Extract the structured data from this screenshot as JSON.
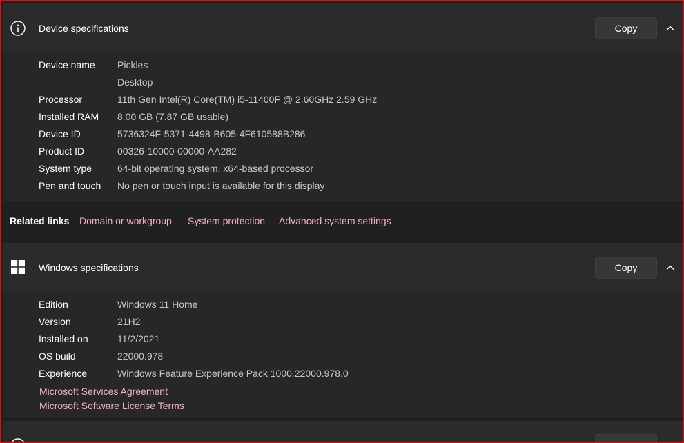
{
  "device_specs": {
    "title": "Device specifications",
    "copy_label": "Copy",
    "rows": [
      {
        "key": "Device name",
        "value": "Pickles"
      },
      {
        "key": "",
        "value": "Desktop"
      },
      {
        "key": "Processor",
        "value": "11th Gen Intel(R) Core(TM) i5-11400F @ 2.60GHz   2.59 GHz"
      },
      {
        "key": "Installed RAM",
        "value": "8.00 GB (7.87 GB usable)"
      },
      {
        "key": "Device ID",
        "value": "5736324F-5371-4498-B605-4F610588B286"
      },
      {
        "key": "Product ID",
        "value": "00326-10000-00000-AA282"
      },
      {
        "key": "System type",
        "value": "64-bit operating system, x64-based processor"
      },
      {
        "key": "Pen and touch",
        "value": "No pen or touch input is available for this display"
      }
    ]
  },
  "related_links": {
    "title": "Related links",
    "links": [
      "Domain or workgroup",
      "System protection",
      "Advanced system settings"
    ]
  },
  "windows_specs": {
    "title": "Windows specifications",
    "copy_label": "Copy",
    "rows": [
      {
        "key": "Edition",
        "value": "Windows 11 Home"
      },
      {
        "key": "Version",
        "value": "21H2"
      },
      {
        "key": "Installed on",
        "value": "11/2/2021"
      },
      {
        "key": "OS build",
        "value": "22000.978"
      },
      {
        "key": "Experience",
        "value": "Windows Feature Experience Pack 1000.22000.978.0"
      }
    ],
    "links": [
      "Microsoft Services Agreement",
      "Microsoft Software License Terms"
    ]
  },
  "colors": {
    "link": "#f0b0cc",
    "background": "#202020",
    "card": "#272727"
  },
  "icons": {
    "device": "info-icon",
    "windows": "windows-logo-icon",
    "collapse": "chevron-up-icon"
  }
}
